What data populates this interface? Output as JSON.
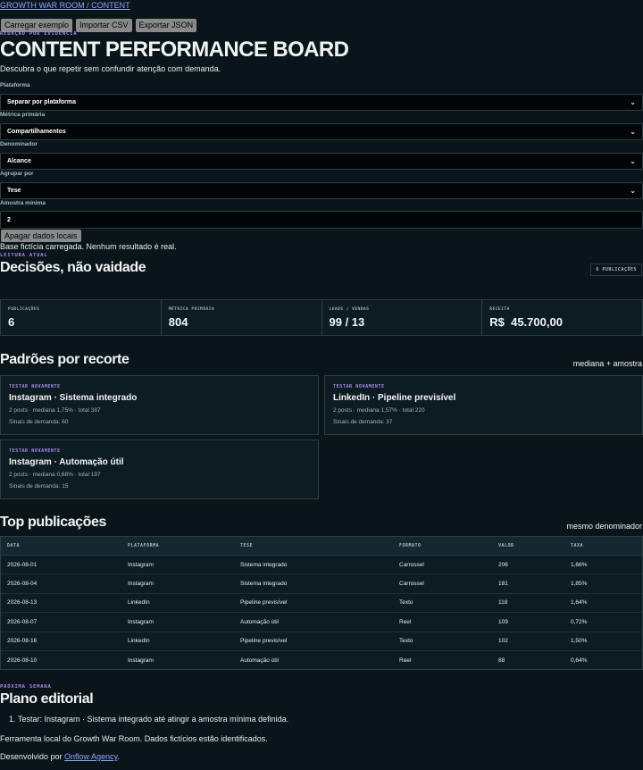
{
  "header": {
    "nav_link": "GROWTH WAR ROOM / CONTENT",
    "buttons": [
      "Carregar exemplo",
      "Importar CSV",
      "Exportar JSON"
    ],
    "eyebrow": "Redação por evidência",
    "title": "CONTENT PERFORMANCE BOARD",
    "subtitle": "Descubra o que repetir sem confundir atenção com demanda."
  },
  "filters": [
    {
      "label": "Plataforma",
      "value": "Separar por plataforma"
    },
    {
      "label": "Métrica primária",
      "value": "Compartilhamentos"
    },
    {
      "label": "Denominador",
      "value": "Alcance"
    },
    {
      "label": "Agrupar por",
      "value": "Tese"
    },
    {
      "label": "Amostra mínima",
      "value": "2"
    }
  ],
  "clear_button": "Apagar dados locais",
  "status_text": "Base fictícia carregada. Nenhum resultado é real.",
  "reading": {
    "eyebrow": "Leitura atual",
    "title": "Decisões, não vaidade",
    "badge": "6 publicações"
  },
  "stats": [
    {
      "label": "Publicações",
      "value": "6"
    },
    {
      "label": "Métrica primária",
      "value": "804"
    },
    {
      "label": "Leads / vendas",
      "value": "99 / 13"
    },
    {
      "label": "Receita",
      "value": "R$  45.700,00"
    }
  ],
  "patterns": {
    "title": "Padrões por recorte",
    "note": "mediana + amostra",
    "cards": [
      {
        "eyebrow": "Testar novamente",
        "title": "Instagram · Sistema integrado",
        "meta": "2 posts · mediana 1,75% · total 387",
        "demand": "Sinais de demanda: 60"
      },
      {
        "eyebrow": "Testar novamente",
        "title": "LinkedIn · Pipeline previsível",
        "meta": "2 posts · mediana 1,57% · total 220",
        "demand": "Sinais de demanda: 37"
      },
      {
        "eyebrow": "Testar novamente",
        "title": "Instagram · Automação útil",
        "meta": "2 posts · mediana 0,68% · total 197",
        "demand": "Sinais de demanda: 15"
      }
    ]
  },
  "top": {
    "title": "Top publicações",
    "note": "mesmo denominador",
    "columns": [
      "Data",
      "Plataforma",
      "Tese",
      "Formato",
      "Valor",
      "Taxa"
    ],
    "rows": [
      [
        "2026-08-01",
        "Instagram",
        "Sistema integrado",
        "Carrossel",
        "206",
        "1,66%"
      ],
      [
        "2026-08-04",
        "Instagram",
        "Sistema integrado",
        "Carrossel",
        "181",
        "1,85%"
      ],
      [
        "2026-08-13",
        "LinkedIn",
        "Pipeline previsível",
        "Texto",
        "118",
        "1,64%"
      ],
      [
        "2026-08-07",
        "Instagram",
        "Automação útil",
        "Reel",
        "109",
        "0,72%"
      ],
      [
        "2026-08-16",
        "LinkedIn",
        "Pipeline previsível",
        "Texto",
        "102",
        "1,50%"
      ],
      [
        "2026-08-10",
        "Instagram",
        "Automação útil",
        "Reel",
        "88",
        "0,64%"
      ]
    ]
  },
  "plan": {
    "eyebrow": "Próxima semana",
    "title": "Plano editorial",
    "items": [
      "Testar: Instagram · Sistema integrado até atingir a amostra mínima definida."
    ]
  },
  "footer": {
    "note": "Ferramenta local do Growth War Room. Dados fictícios estão identificados.",
    "credit_prefix": "Desenvolvido por ",
    "credit_link": "Onflow Agency",
    "credit_suffix": "."
  }
}
